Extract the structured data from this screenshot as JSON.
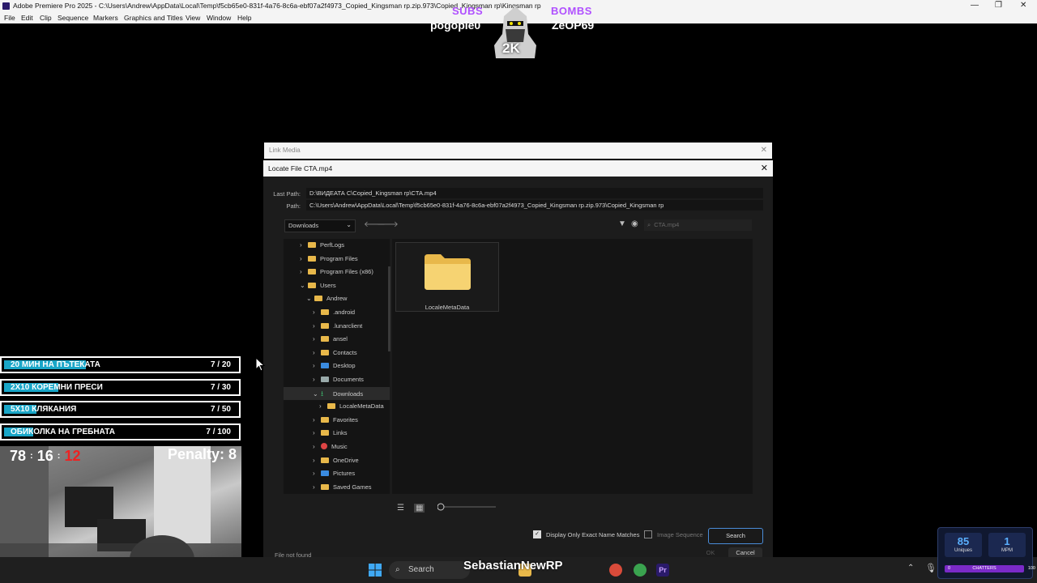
{
  "window": {
    "title": "Adobe Premiere Pro 2025 - C:\\Users\\Andrew\\AppData\\Local\\Temp\\f5cb65e0-831f-4a76-8c6a-ebf07a2f4973_Copied_Kingsman rp.zip.973\\Copied_Kingsman rp\\Kingsman rp",
    "controls": {
      "minimize": "—",
      "maximize": "❐",
      "close": "✕"
    }
  },
  "menu": [
    "File",
    "Edit",
    "Clip",
    "Sequence",
    "Markers",
    "Graphics and Titles",
    "View",
    "Window",
    "Help"
  ],
  "overlay": {
    "subs_label": "SUBS",
    "subs_name": "pogopie0",
    "bombs_label": "BOMBS",
    "bombs_name": "ZeOP69",
    "badge": "2K"
  },
  "link_media": {
    "title": "Link Media",
    "close": "✕"
  },
  "locate": {
    "title": "Locate File CTA.mp4",
    "close": "✕",
    "last_path_label": "Last Path:",
    "last_path": "D:\\ВИДЕАТА С\\Copied_Kingsman rp\\CTA.mp4",
    "path_label": "Path:",
    "path": "C:\\Users\\Andrew\\AppData\\Local\\Temp\\f5cb65e0-831f-4a76-8c6a-ebf07a2f4973_Copied_Kingsman rp.zip.973\\Copied_Kingsman rp",
    "location": "Downloads",
    "search_placeholder": "CTA.mp4",
    "tree": [
      {
        "label": "PerfLogs",
        "arrow": "›",
        "icon": "folder"
      },
      {
        "label": "Program Files",
        "arrow": "›",
        "icon": "folder"
      },
      {
        "label": "Program Files (x86)",
        "arrow": "›",
        "icon": "folder"
      },
      {
        "label": "Users",
        "arrow": "⌄",
        "icon": "folder"
      },
      {
        "label": "Andrew",
        "arrow": "⌄",
        "icon": "folder"
      },
      {
        "label": ".android",
        "arrow": "›",
        "icon": "folder"
      },
      {
        "label": ".lunarclient",
        "arrow": "›",
        "icon": "folder"
      },
      {
        "label": "ansel",
        "arrow": "›",
        "icon": "folder"
      },
      {
        "label": "Contacts",
        "arrow": "›",
        "icon": "folder"
      },
      {
        "label": "Desktop",
        "arrow": "›",
        "icon": "blue"
      },
      {
        "label": "Documents",
        "arrow": "›",
        "icon": "doc"
      },
      {
        "label": "Downloads",
        "arrow": "⌄",
        "icon": "dl"
      },
      {
        "label": "LocaleMetaData",
        "arrow": "›",
        "icon": "folder"
      },
      {
        "label": "Favorites",
        "arrow": "›",
        "icon": "folder"
      },
      {
        "label": "Links",
        "arrow": "›",
        "icon": "folder"
      },
      {
        "label": "Music",
        "arrow": "›",
        "icon": "red"
      },
      {
        "label": "OneDrive",
        "arrow": "›",
        "icon": "folder"
      },
      {
        "label": "Pictures",
        "arrow": "›",
        "icon": "blue"
      },
      {
        "label": "Saved Games",
        "arrow": "›",
        "icon": "folder"
      }
    ],
    "files": [
      {
        "name": "LocaleMetaData"
      }
    ],
    "exact_match_label": "Display Only Exact Name Matches",
    "exact_match_checked": true,
    "image_sequence_label": "Image Sequence",
    "image_sequence_checked": false,
    "search_button": "Search",
    "ok_button": "OK",
    "cancel_button": "Cancel",
    "status": "File not found"
  },
  "challenges": [
    {
      "label": "20 МИН НА ПЪТЕКАТА",
      "done": 7,
      "total": 20,
      "count": "7 / 20"
    },
    {
      "label": "2X10 КОРЕМНИ ПРЕСИ",
      "done": 7,
      "total": 30,
      "count": "7 / 30"
    },
    {
      "label": "5X10 КЛЯКАНИЯ",
      "done": 7,
      "total": 50,
      "count": "7 / 50"
    },
    {
      "label": "ОБИКОЛКА НА ГРЕБНАТА",
      "done": 7,
      "total": 100,
      "count": "7 / 100"
    }
  ],
  "cam": {
    "timer_h": "78",
    "timer_m": "16",
    "timer_s": "12",
    "sep": ":",
    "penalty": "Penalty: 8"
  },
  "taskbar": {
    "search": "Search",
    "streamer": "SebastianNewRP"
  },
  "stats": {
    "uniques": "85",
    "uniques_label": "Uniques",
    "mpm": "1",
    "mpm_label": "MPM",
    "chatters_label": "CHATTERS",
    "chatters_min": "0",
    "chatters_max": "100"
  }
}
